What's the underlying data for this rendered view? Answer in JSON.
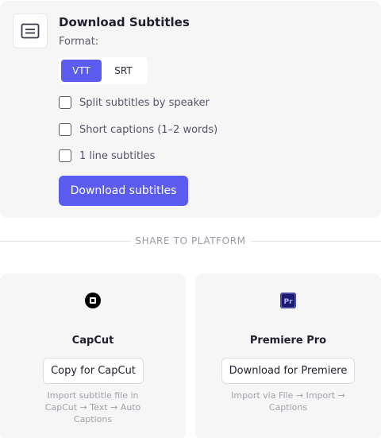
{
  "download": {
    "title": "Download Subtitles",
    "format_label": "Format:",
    "formats": [
      "VTT",
      "SRT"
    ],
    "selected_format": "VTT",
    "options": [
      {
        "label": "Split subtitles by speaker",
        "checked": false
      },
      {
        "label": "Short captions (1–2 words)",
        "checked": false
      },
      {
        "label": "1 line subtitles",
        "checked": false
      }
    ],
    "button_label": "Download subtitles",
    "icon": "subtitles-icon"
  },
  "share": {
    "label": "SHARE TO PLATFORM"
  },
  "platforms": [
    {
      "name": "CapCut",
      "icon": "capcut-icon",
      "button_label": "Copy for CapCut",
      "note": "Import subtitle file in CapCut → Text → Auto Captions"
    },
    {
      "name": "Premiere Pro",
      "icon": "premiere-pro-icon",
      "button_label": "Download for Premiere",
      "note": "Import via File → Import → Captions"
    }
  ],
  "colors": {
    "accent": "#5b5bf0",
    "card_bg": "#f6f6f7",
    "premiere_icon": "#1a1a6e"
  }
}
